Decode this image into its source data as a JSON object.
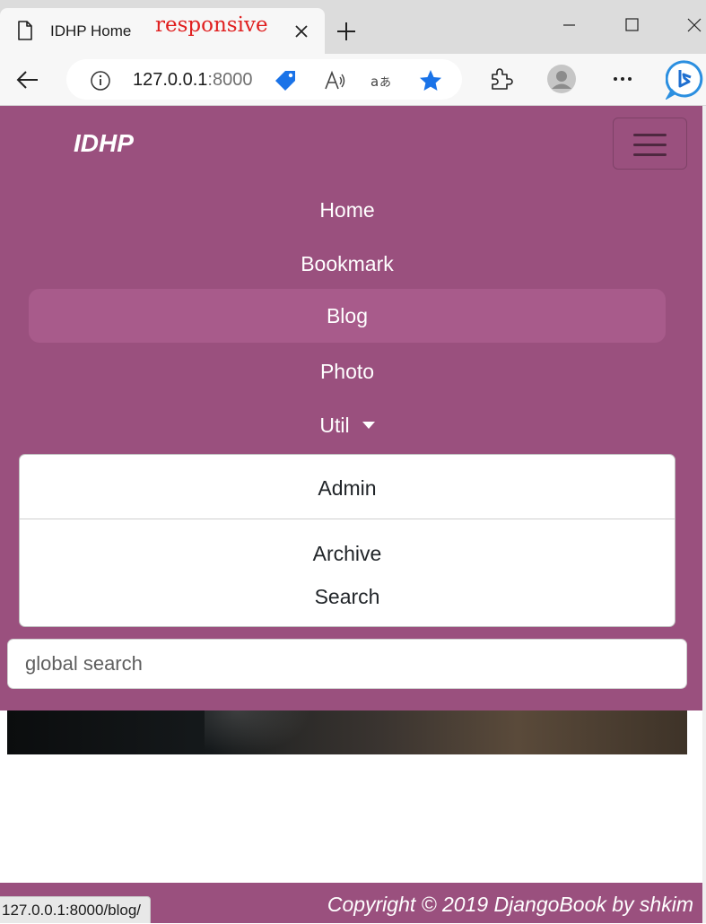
{
  "browser": {
    "tab_title": "IDHP Home",
    "tab_badge": "responsive",
    "url_host": "127.0.0.1",
    "url_port": ":8000",
    "status_url": "127.0.0.1:8000/blog/",
    "icons": [
      "page-icon",
      "close-icon",
      "plus-icon",
      "minimize-icon",
      "maximize-icon",
      "back-arrow-icon",
      "info-icon",
      "tag-icon",
      "read-aloud-icon",
      "translate-icon",
      "star-icon",
      "extensions-icon",
      "profile-icon",
      "more-icon",
      "bing-icon"
    ],
    "accent_star": "#1a73e8"
  },
  "navbar": {
    "brand": "IDHP",
    "items": [
      {
        "label": "Home",
        "active": false
      },
      {
        "label": "Bookmark",
        "active": false
      },
      {
        "label": "Blog",
        "active": true
      },
      {
        "label": "Photo",
        "active": false
      },
      {
        "label": "Util",
        "active": false
      }
    ],
    "dropdown": [
      "Admin",
      "Archive",
      "Search"
    ],
    "search_placeholder": "global search",
    "bg_color": "#9a507e",
    "active_color": "#a85b8b"
  },
  "footer": {
    "text": "Copyright © 2019 DjangoBook by shkim"
  }
}
